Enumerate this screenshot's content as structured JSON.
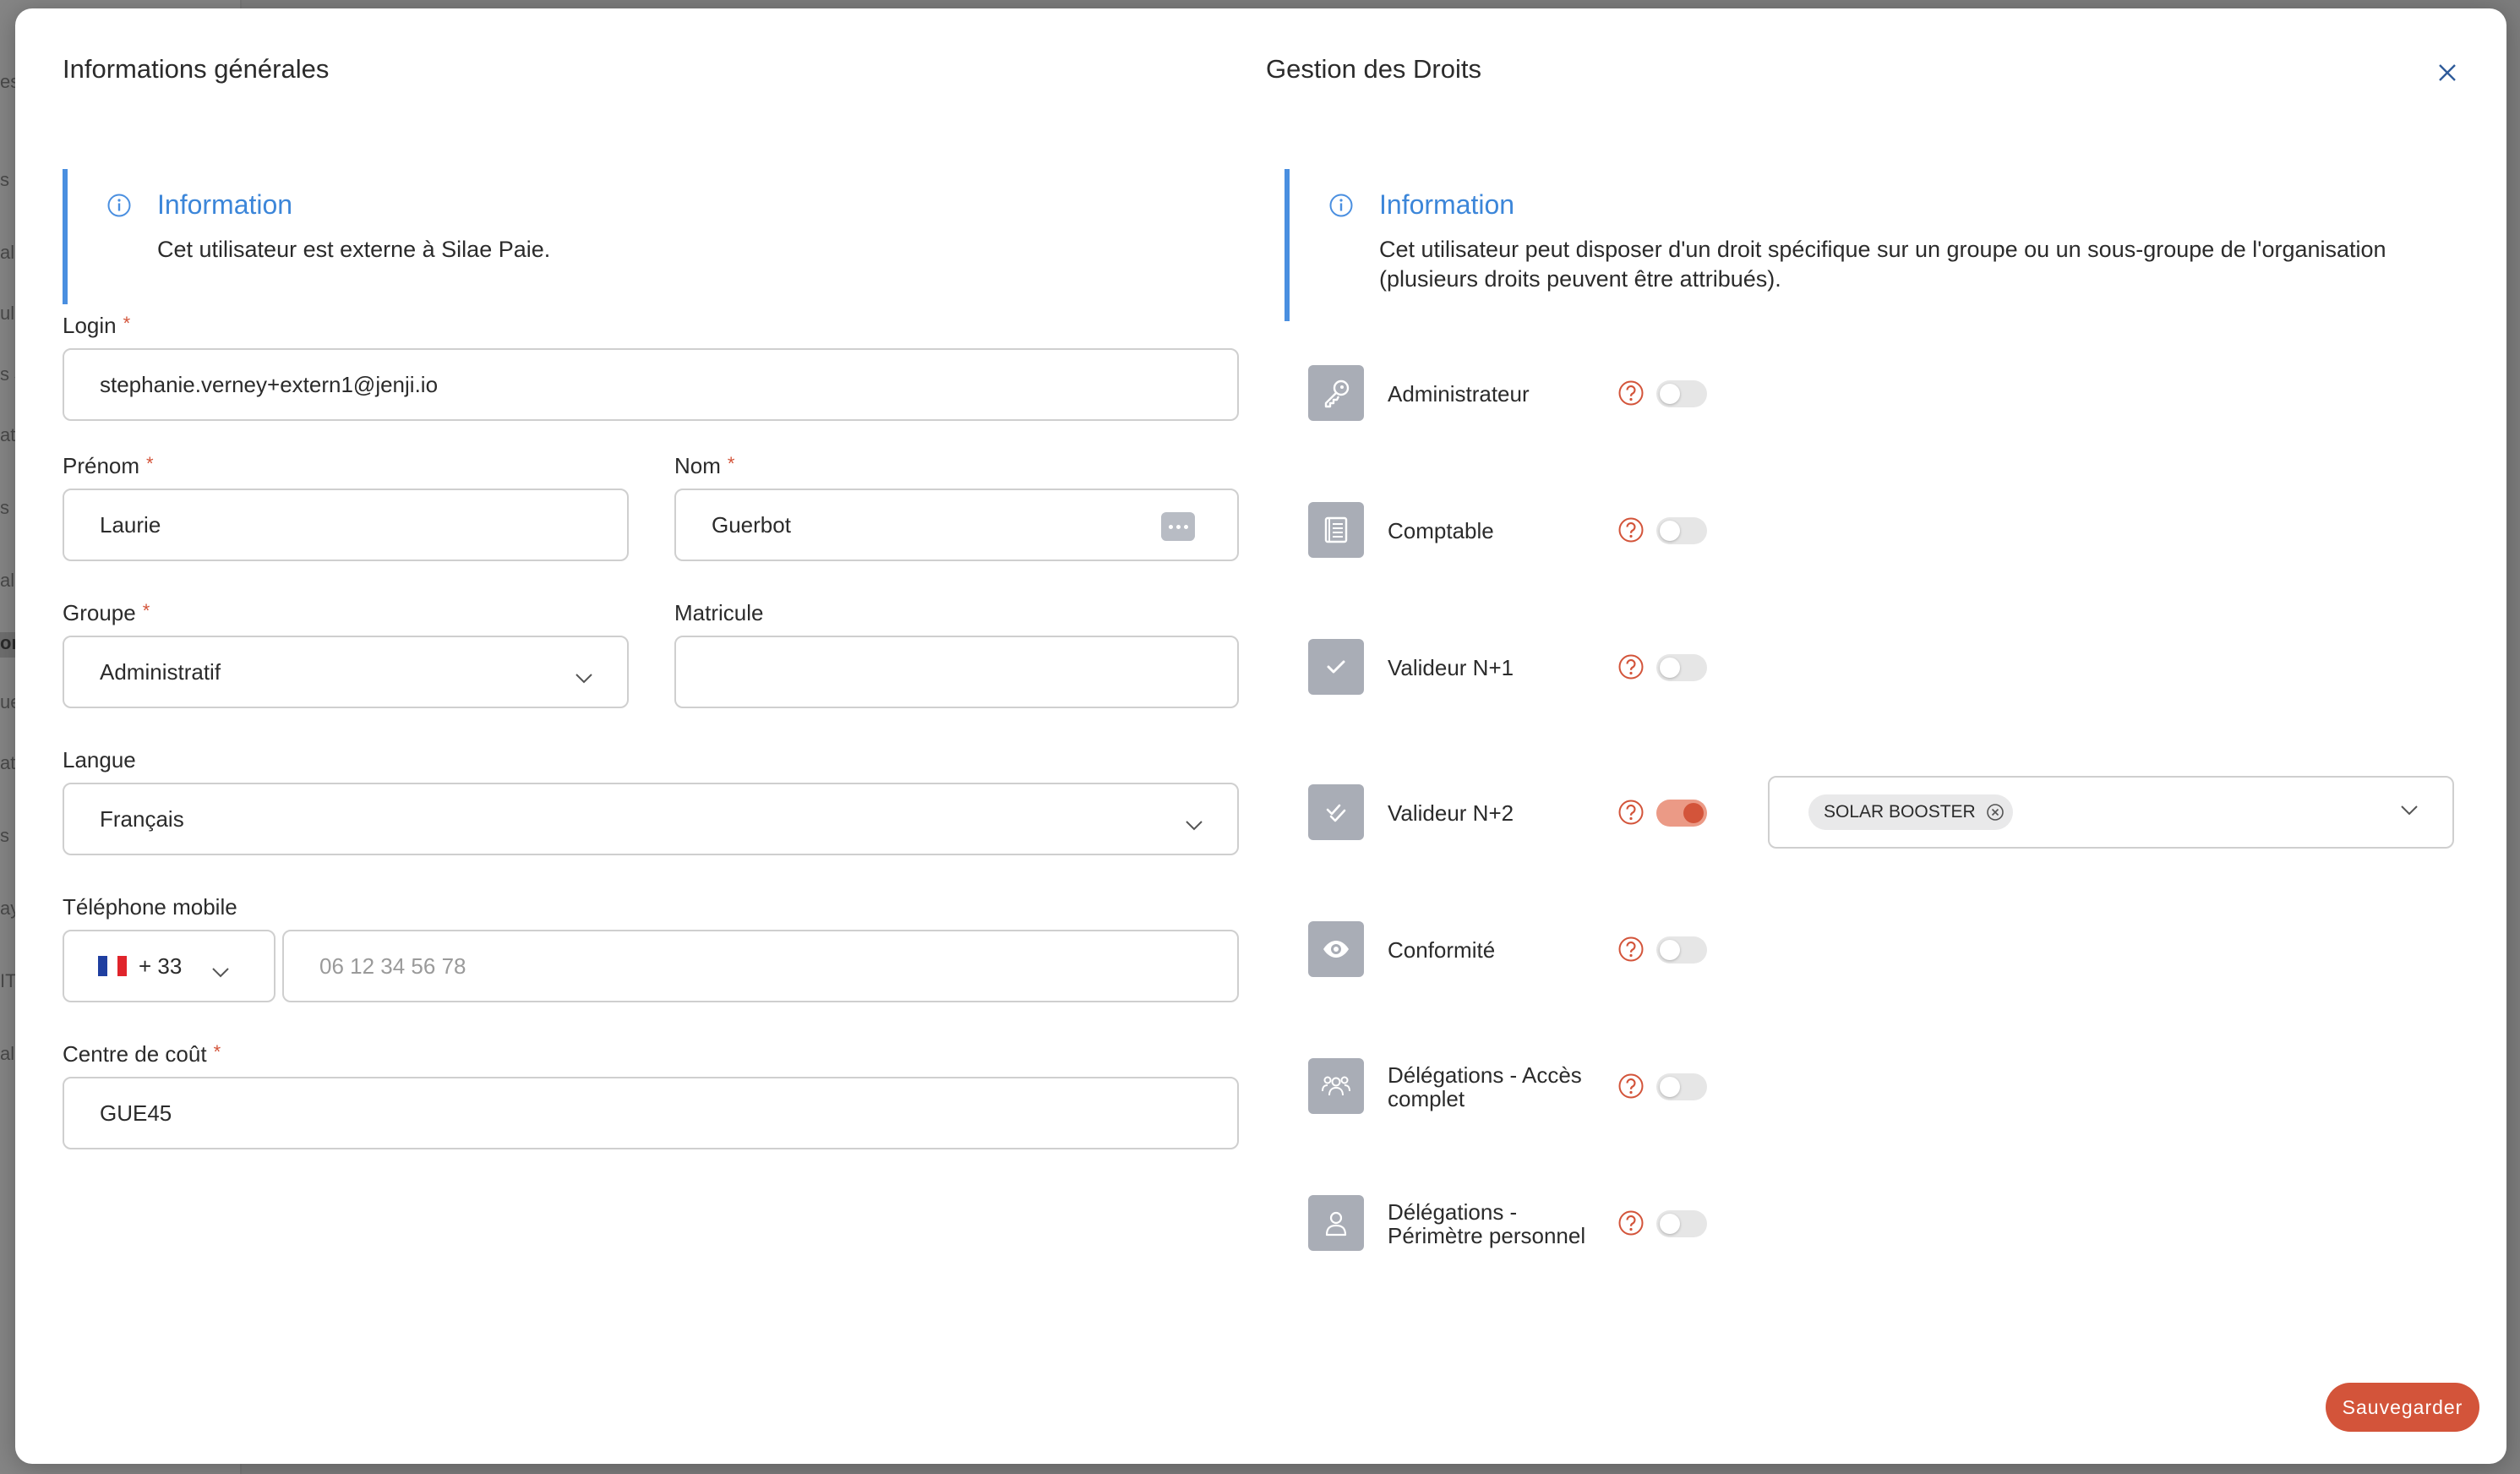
{
  "colors": {
    "accent": "#d3543a",
    "info_blue": "#3c86d9",
    "icon_bg": "#a9adb6"
  },
  "left_section": {
    "title": "Informations générales",
    "callout": {
      "title": "Information",
      "text": "Cet utilisateur est externe à Silae Paie.",
      "icon": "info-icon"
    },
    "required_marker": "*",
    "login": {
      "label": "Login",
      "value": "stephanie.verney+extern1@jenji.io"
    },
    "prenom": {
      "label": "Prénom",
      "value": "Laurie"
    },
    "nom": {
      "label": "Nom",
      "value": "Guerbot"
    },
    "groupe": {
      "label": "Groupe",
      "value": "Administratif"
    },
    "matricule": {
      "label": "Matricule",
      "value": ""
    },
    "langue": {
      "label": "Langue",
      "value": "Français"
    },
    "telephone": {
      "label": "Téléphone mobile",
      "country_code": "+ 33",
      "placeholder": "06 12 34 56 78",
      "value": ""
    },
    "centre_cout": {
      "label": "Centre de coût",
      "value": "GUE45"
    }
  },
  "right_section": {
    "title": "Gestion des Droits",
    "callout": {
      "title": "Information",
      "text_line1": "Cet utilisateur peut disposer d'un droit spécifique sur un groupe ou un sous-groupe de l'organisation",
      "text_line2": "(plusieurs droits peuvent être attribués).",
      "icon": "info-icon"
    },
    "rights": [
      {
        "label": "Administrateur",
        "icon": "key-icon",
        "enabled": false
      },
      {
        "label": "Comptable",
        "icon": "ledger-icon",
        "enabled": false
      },
      {
        "label": "Valideur N+1",
        "icon": "check-icon",
        "enabled": false
      },
      {
        "label": "Valideur N+2",
        "icon": "double-check-icon",
        "enabled": true
      },
      {
        "label": "Conformité",
        "icon": "eye-icon",
        "enabled": false
      },
      {
        "label_line1": "Délégations - Accès",
        "label_line2": "complet",
        "icon": "group-icon",
        "enabled": false
      },
      {
        "label_line1": "Délégations -",
        "label_line2": "Périmètre personnel",
        "icon": "person-icon",
        "enabled": false
      }
    ],
    "valideur_n2_scope": {
      "chip": "SOLAR BOOSTER"
    }
  },
  "actions": {
    "save_label": "Sauvegarder"
  },
  "backdrop_fragments": [
    "es",
    "s P",
    "al",
    "ule",
    "s J",
    "at",
    "s S",
    "al",
    "on",
    "ue",
    "at",
    "s F",
    "ay",
    "IT",
    "al"
  ]
}
